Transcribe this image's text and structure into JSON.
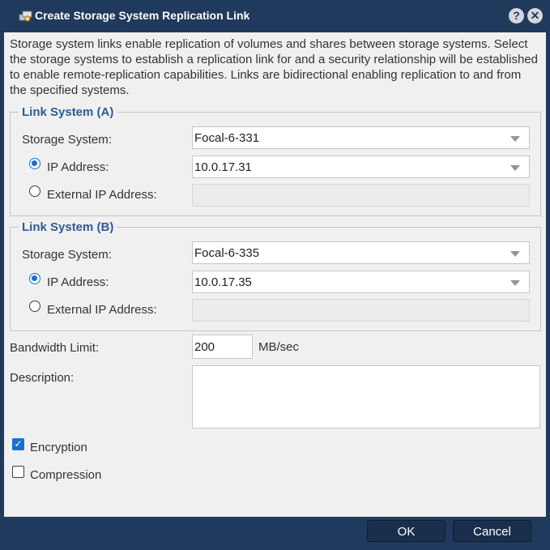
{
  "dialog": {
    "title": "Create Storage System Replication Link",
    "help_icon": "question-circle-icon",
    "close_icon": "close-circle-icon",
    "intro": "Storage system links enable replication of volumes and shares between storage systems. Select the storage systems to establish a replication link for and a security relationship will be established to enable remote-replication capabilities. Links are bidirectional enabling replication to and from the specified systems."
  },
  "link_a": {
    "legend": "Link System (A)",
    "storage_label": "Storage System:",
    "storage_value": "Focal-6-331",
    "ip_label": "IP Address:",
    "ip_value": "10.0.17.31",
    "ip_selected": true,
    "external_label": "External IP Address:",
    "external_value": ""
  },
  "link_b": {
    "legend": "Link System (B)",
    "storage_label": "Storage System:",
    "storage_value": "Focal-6-335",
    "ip_label": "IP Address:",
    "ip_value": "10.0.17.35",
    "ip_selected": true,
    "external_label": "External IP Address:",
    "external_value": ""
  },
  "bandwidth": {
    "label": "Bandwidth Limit:",
    "value": "200",
    "unit": "MB/sec"
  },
  "description": {
    "label": "Description:",
    "value": ""
  },
  "options": {
    "encryption_label": "Encryption",
    "encryption_checked": true,
    "compression_label": "Compression",
    "compression_checked": false
  },
  "buttons": {
    "ok": "OK",
    "cancel": "Cancel"
  },
  "colors": {
    "header": "#1f3a5c",
    "body": "#f0f0f0",
    "legend": "#2e5b97",
    "accent": "#1a6fd1"
  }
}
